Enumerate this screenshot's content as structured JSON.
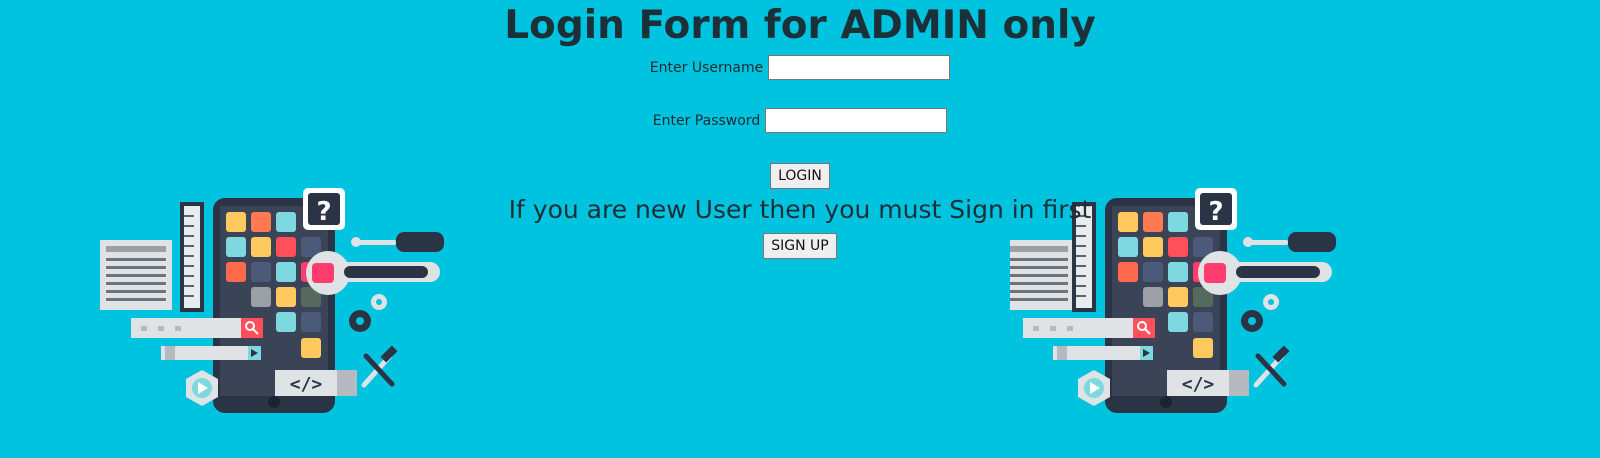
{
  "title": "Login Form for ADMIN only",
  "form": {
    "username_label": "Enter Username",
    "username_value": "",
    "password_label": "Enter Password",
    "password_value": "",
    "login_button": "LOGIN"
  },
  "signup": {
    "notice": "If you are new User then you must Sign in first",
    "button": "SIGN UP"
  },
  "colors": {
    "background": "#00c3e0",
    "text": "#1c3038"
  },
  "illustration": {
    "code_tag": "</>",
    "question_mark": "?"
  }
}
